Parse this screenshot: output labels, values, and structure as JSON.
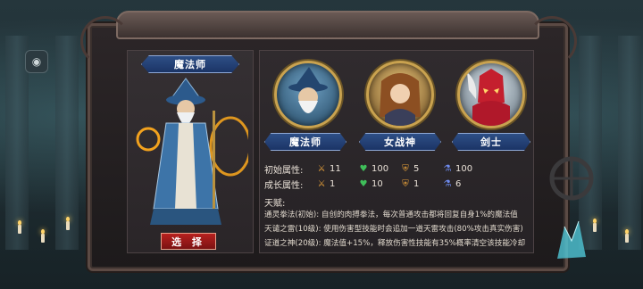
{
  "selected_hero": {
    "name": "魔法师",
    "select_label": "选 择"
  },
  "heroes": [
    {
      "name": "魔法师"
    },
    {
      "name": "女战神"
    },
    {
      "name": "剑士"
    }
  ],
  "stats": {
    "initial_label": "初始属性:",
    "growth_label": "成长属性:",
    "initial": {
      "attack": "11",
      "hp": "100",
      "defense": "5",
      "mana": "100"
    },
    "growth": {
      "attack": "1",
      "hp": "10",
      "defense": "1",
      "mana": "6"
    }
  },
  "talent": {
    "title": "天赋:",
    "lines": [
      "通灵拳法(初始): 自创的肉搏拳法，每次普通攻击都将回复自身1%的魔法值",
      "天谴之雷(10级): 使用伤害型技能时会追加一道天雷攻击(80%攻击真实伤害)",
      "证道之神(20级): 魔法值+15%，释放伤害性技能有35%概率清空该技能冷却"
    ]
  },
  "icons": [
    "attack-icon",
    "hp-icon",
    "defense-icon",
    "mana-icon",
    "camera-icon",
    "sword-icon",
    "heart-icon",
    "shield-icon",
    "potion-icon"
  ]
}
